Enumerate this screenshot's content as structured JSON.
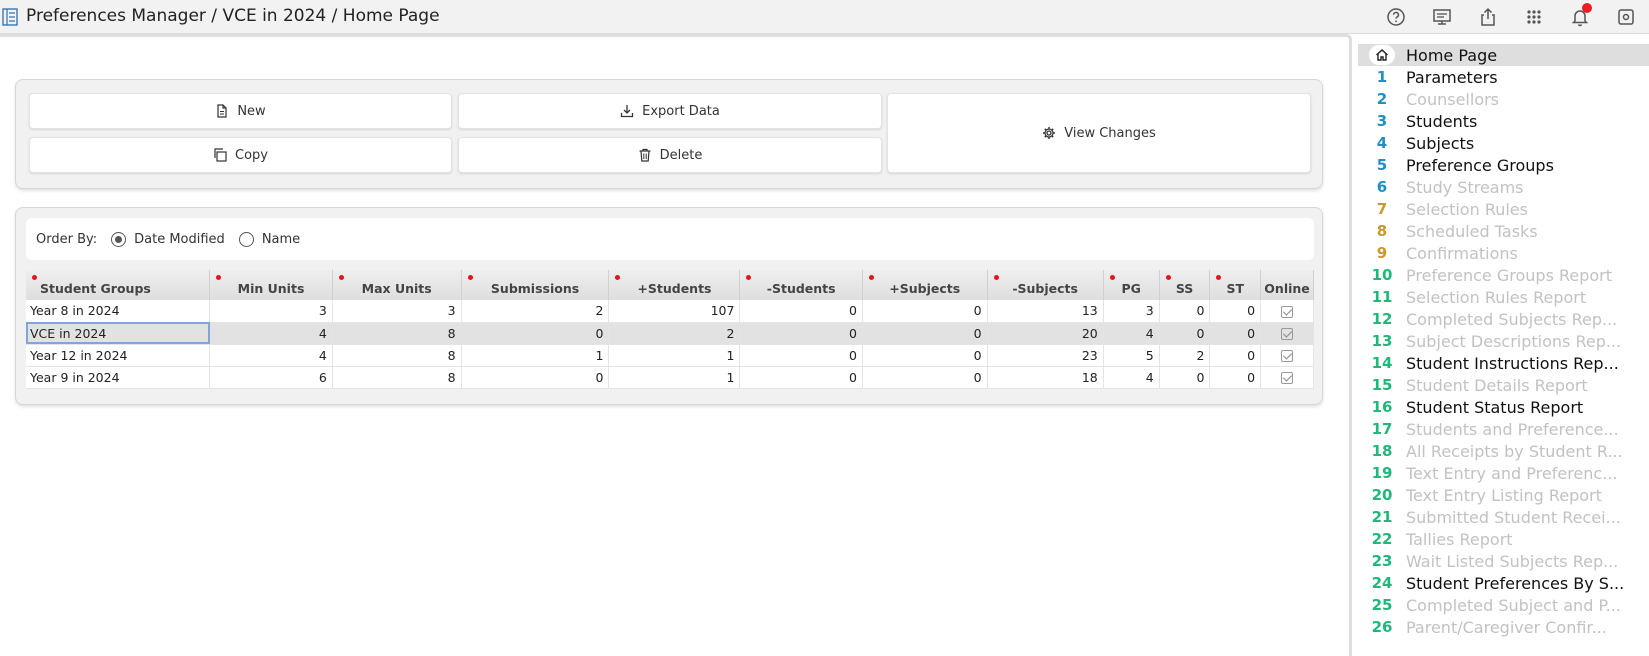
{
  "header": {
    "title": "Preferences Manager / VCE in 2024 / Home Page"
  },
  "toolbar_icons": [
    "help-icon",
    "presentation-icon",
    "share-icon",
    "apps-grid-icon",
    "bell-icon",
    "settings-icon"
  ],
  "actions": {
    "new_label": "New",
    "export_label": "Export Data",
    "copy_label": "Copy",
    "delete_label": "Delete",
    "view_changes_label": "View Changes"
  },
  "order_by": {
    "label": "Order By:",
    "options": [
      "Date Modified",
      "Name"
    ],
    "selected": "Date Modified"
  },
  "table": {
    "columns": [
      "Student Groups",
      "Min Units",
      "Max Units",
      "Submissions",
      "+Students",
      "-Students",
      "+Subjects",
      "-Subjects",
      "PG",
      "SS",
      "ST",
      "Online"
    ],
    "rows": [
      {
        "name": "Year 8 in 2024",
        "min": "3",
        "max": "3",
        "submissions": "2",
        "plus_students": "107",
        "minus_students": "0",
        "plus_subjects": "0",
        "minus_subjects": "13",
        "pg": "3",
        "ss": "0",
        "st": "0",
        "online": true
      },
      {
        "name": "VCE in 2024",
        "min": "4",
        "max": "8",
        "submissions": "0",
        "plus_students": "2",
        "minus_students": "0",
        "plus_subjects": "0",
        "minus_subjects": "20",
        "pg": "4",
        "ss": "0",
        "st": "0",
        "online": true
      },
      {
        "name": "Year 12 in 2024",
        "min": "4",
        "max": "8",
        "submissions": "1",
        "plus_students": "1",
        "minus_students": "0",
        "plus_subjects": "0",
        "minus_subjects": "23",
        "pg": "5",
        "ss": "2",
        "st": "0",
        "online": true
      },
      {
        "name": "Year 9 in 2024",
        "min": "6",
        "max": "8",
        "submissions": "0",
        "plus_students": "1",
        "minus_students": "0",
        "plus_subjects": "0",
        "minus_subjects": "18",
        "pg": "4",
        "ss": "0",
        "st": "0",
        "online": true
      }
    ]
  },
  "nav": {
    "home_label": "Home Page",
    "items": [
      {
        "num": "1",
        "label": "Parameters",
        "enabled": true,
        "color": "#1f8fc6"
      },
      {
        "num": "2",
        "label": "Counsellors",
        "enabled": false,
        "color": "#1f8fc6"
      },
      {
        "num": "3",
        "label": "Students",
        "enabled": true,
        "color": "#1f8fc6"
      },
      {
        "num": "4",
        "label": "Subjects",
        "enabled": true,
        "color": "#1f8fc6"
      },
      {
        "num": "5",
        "label": "Preference Groups",
        "enabled": true,
        "color": "#1f8fc6"
      },
      {
        "num": "6",
        "label": "Study Streams",
        "enabled": false,
        "color": "#1f8fc6"
      },
      {
        "num": "7",
        "label": "Selection Rules",
        "enabled": false,
        "color": "#c79a2a"
      },
      {
        "num": "8",
        "label": "Scheduled Tasks",
        "enabled": false,
        "color": "#c79a2a"
      },
      {
        "num": "9",
        "label": "Confirmations",
        "enabled": false,
        "color": "#c79a2a"
      },
      {
        "num": "10",
        "label": "Preference Groups Report",
        "enabled": false,
        "color": "#1fb87a"
      },
      {
        "num": "11",
        "label": "Selection Rules Report",
        "enabled": false,
        "color": "#1fb87a"
      },
      {
        "num": "12",
        "label": "Completed Subjects Rep...",
        "enabled": false,
        "color": "#1fb87a"
      },
      {
        "num": "13",
        "label": "Subject Descriptions Rep...",
        "enabled": false,
        "color": "#1fb87a"
      },
      {
        "num": "14",
        "label": "Student Instructions Rep...",
        "enabled": true,
        "color": "#1fb87a"
      },
      {
        "num": "15",
        "label": "Student Details Report",
        "enabled": false,
        "color": "#1fb87a"
      },
      {
        "num": "16",
        "label": "Student Status Report",
        "enabled": true,
        "color": "#1fb87a"
      },
      {
        "num": "17",
        "label": "Students and Preference...",
        "enabled": false,
        "color": "#1fb87a"
      },
      {
        "num": "18",
        "label": "All Receipts by Student R...",
        "enabled": false,
        "color": "#1fb87a"
      },
      {
        "num": "19",
        "label": "Text Entry and Preferenc...",
        "enabled": false,
        "color": "#1fb87a"
      },
      {
        "num": "20",
        "label": "Text Entry Listing Report",
        "enabled": false,
        "color": "#1fb87a"
      },
      {
        "num": "21",
        "label": "Submitted Student Recei...",
        "enabled": false,
        "color": "#1fb87a"
      },
      {
        "num": "22",
        "label": "Tallies Report",
        "enabled": false,
        "color": "#1fb87a"
      },
      {
        "num": "23",
        "label": "Wait Listed Subjects Rep...",
        "enabled": false,
        "color": "#1fb87a"
      },
      {
        "num": "24",
        "label": "Student Preferences By S...",
        "enabled": true,
        "color": "#1fb87a"
      },
      {
        "num": "25",
        "label": "Completed Subject and P...",
        "enabled": false,
        "color": "#1fb87a"
      },
      {
        "num": "26",
        "label": "Parent/Caregiver Confir...",
        "enabled": false,
        "color": "#1fb87a"
      }
    ]
  }
}
